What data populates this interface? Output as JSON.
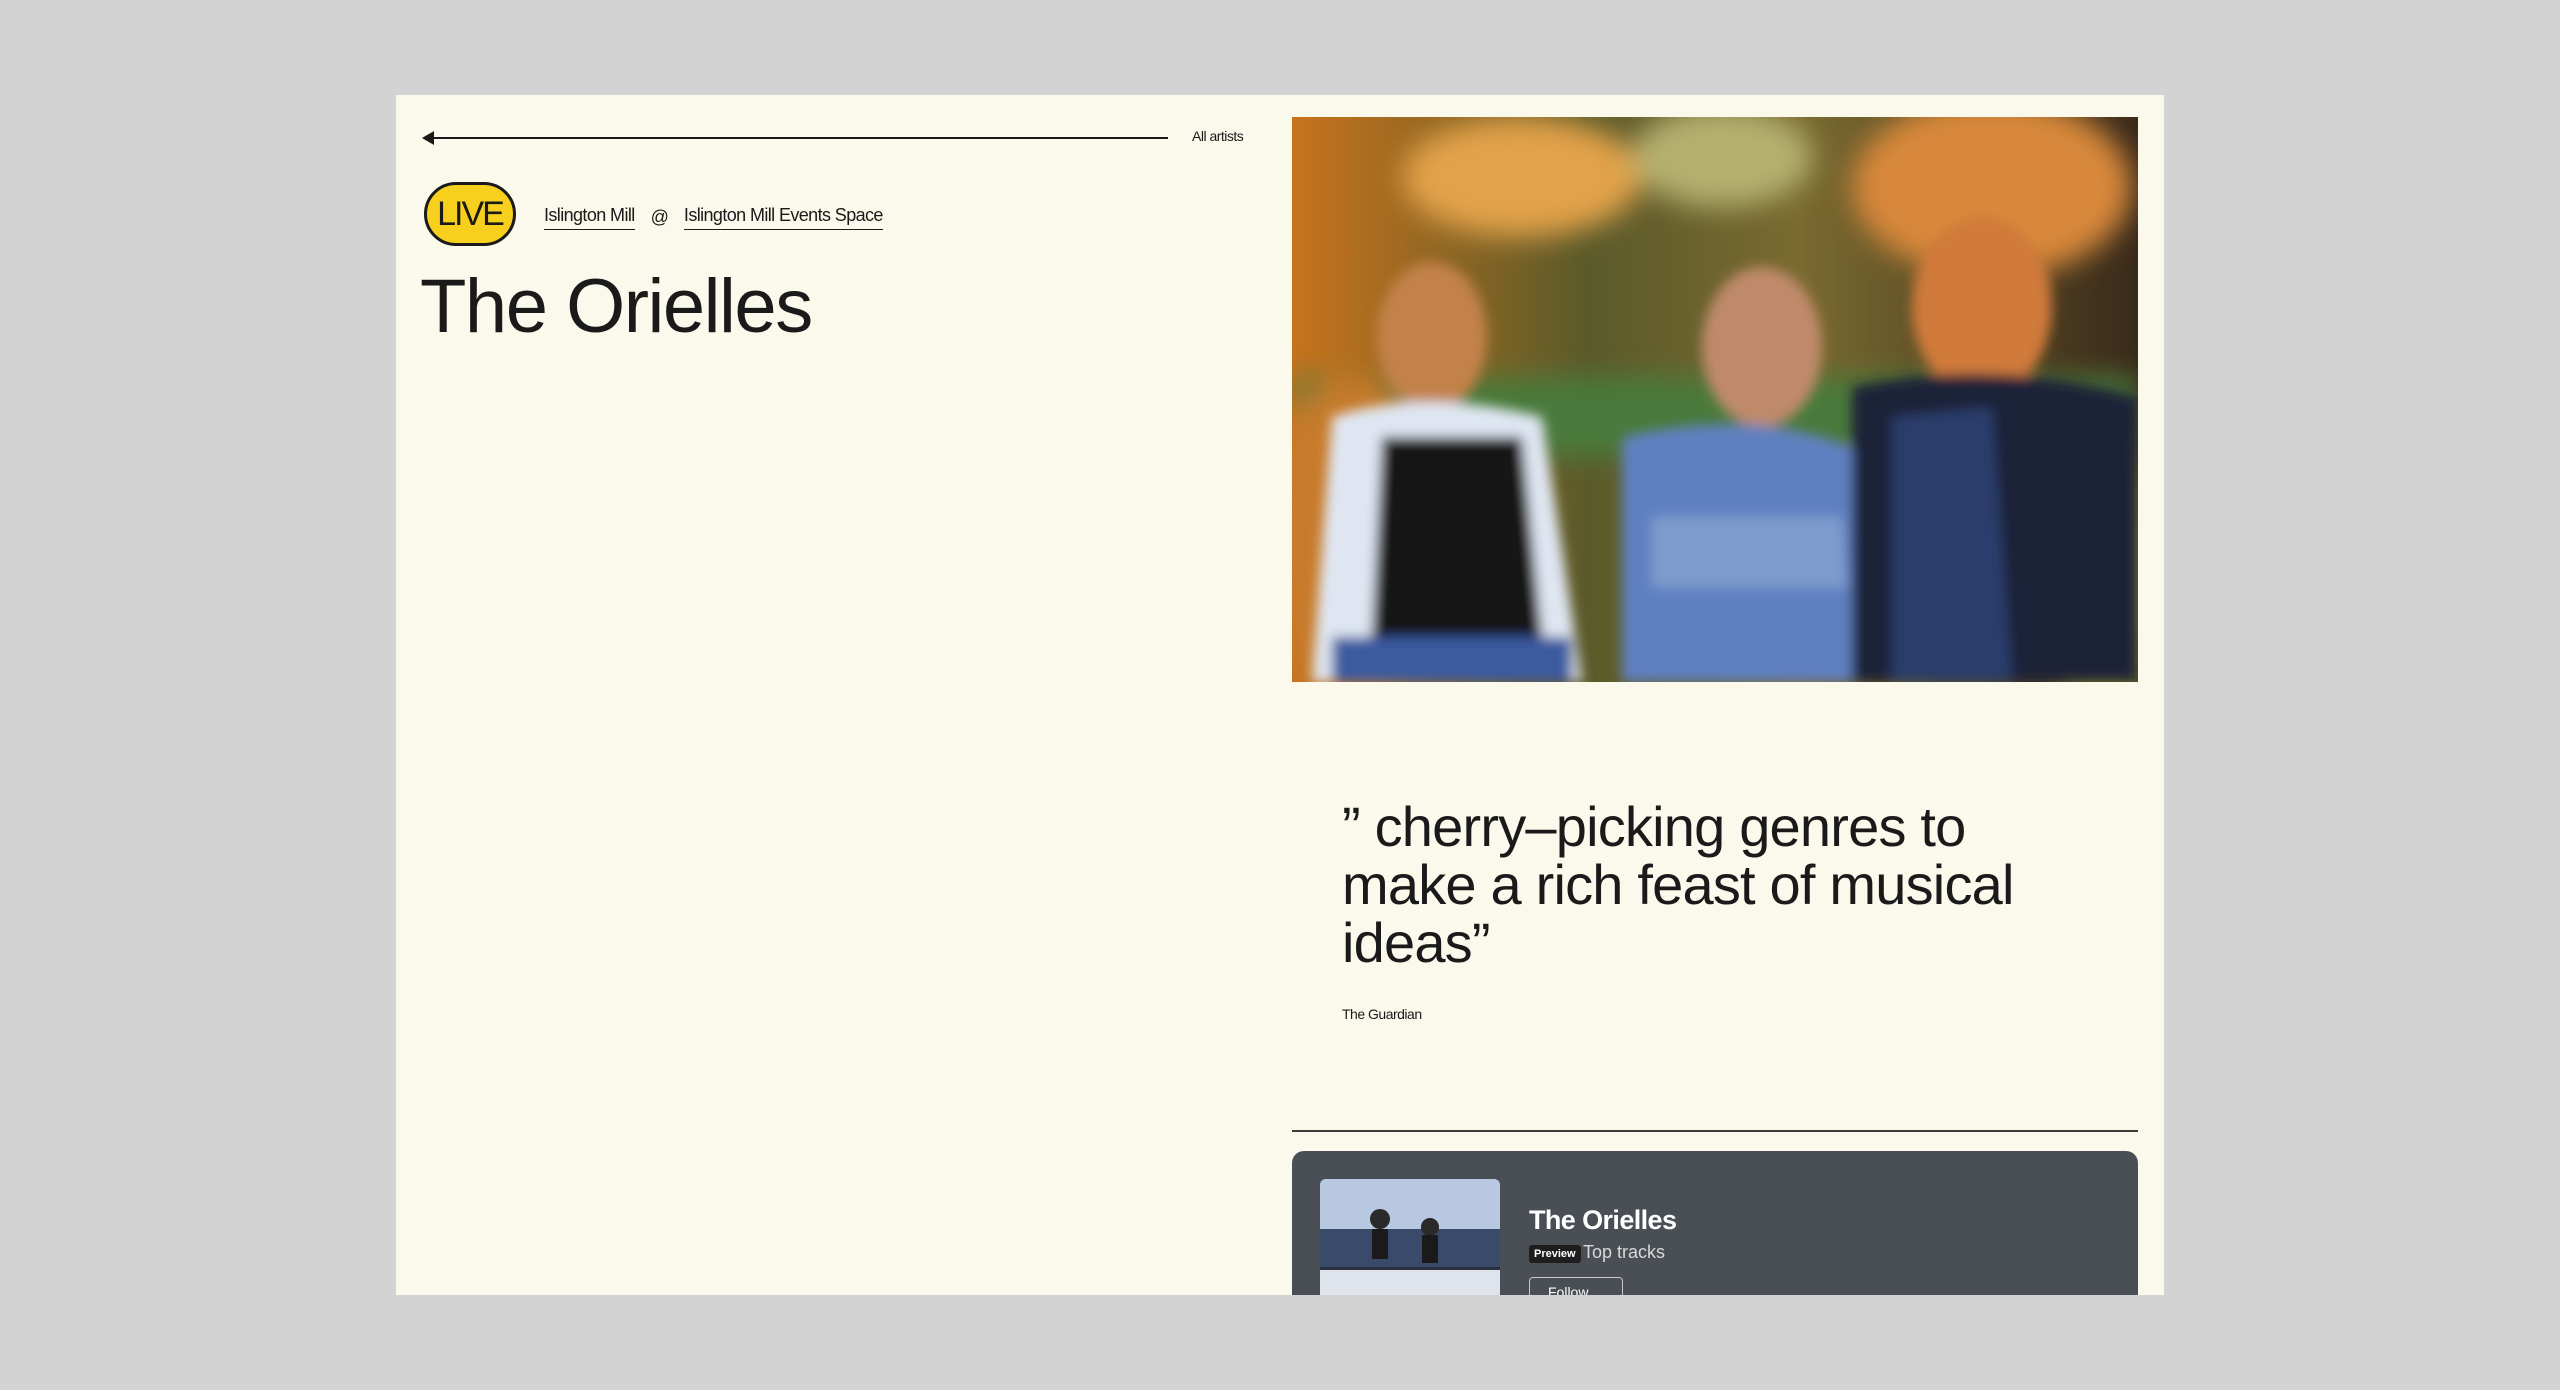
{
  "nav": {
    "back_label": "All artists"
  },
  "event": {
    "live_label": "LIVE",
    "venue": "Islington Mill",
    "at_symbol": "@",
    "space": "Islington Mill Events Space"
  },
  "artist": {
    "name": "The Orielles"
  },
  "quote": {
    "text": "” cherry–picking genres to make a rich feast of musical ideas”",
    "source": "The Guardian"
  },
  "spotify": {
    "artist": "The Orielles",
    "preview_label": "Preview",
    "subtitle": "Top tracks",
    "follow_label": "Follow",
    "icon": "spotify-icon"
  },
  "colors": {
    "page_bg": "#fbf8ec",
    "outer_bg": "#d3d3d3",
    "live_badge": "#f7d01e",
    "spotify_card": "#4a4e55"
  }
}
